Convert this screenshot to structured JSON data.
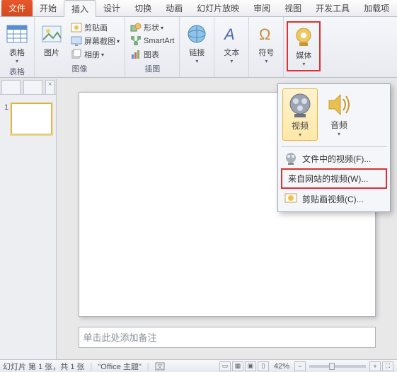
{
  "tabs": {
    "file": "文件",
    "home": "开始",
    "insert": "插入",
    "design": "设计",
    "transitions": "切换",
    "animation": "动画",
    "slideshow": "幻灯片放映",
    "review": "审阅",
    "view": "视图",
    "developer": "开发工具",
    "addin": "加载项"
  },
  "groups": {
    "tables": {
      "title": "表格",
      "table": "表格"
    },
    "images": {
      "title": "图像",
      "picture": "图片",
      "clipart": "剪贴画",
      "screenshot": "屏幕截图",
      "album": "相册"
    },
    "illus": {
      "title": "插图",
      "shapes": "形状",
      "smartart": "SmartArt",
      "chart": "图表"
    },
    "link": {
      "link": "链接"
    },
    "text": {
      "text": "文本"
    },
    "symbol": {
      "symbol": "符号"
    },
    "media": {
      "media": "媒体"
    }
  },
  "dropdown": {
    "video": "视频",
    "audio": "音频",
    "fromFile": "文件中的视频(F)...",
    "fromWeb": "来自网站的视频(W)...",
    "fromClipart": "剪贴画视频(C)..."
  },
  "thumbnail": {
    "num": "1"
  },
  "notes": {
    "placeholder": "单击此处添加备注"
  },
  "status": {
    "slideinfo": "幻灯片 第 1 张，共 1 张",
    "theme": "\"Office 主题\"",
    "zoom": "42%"
  }
}
